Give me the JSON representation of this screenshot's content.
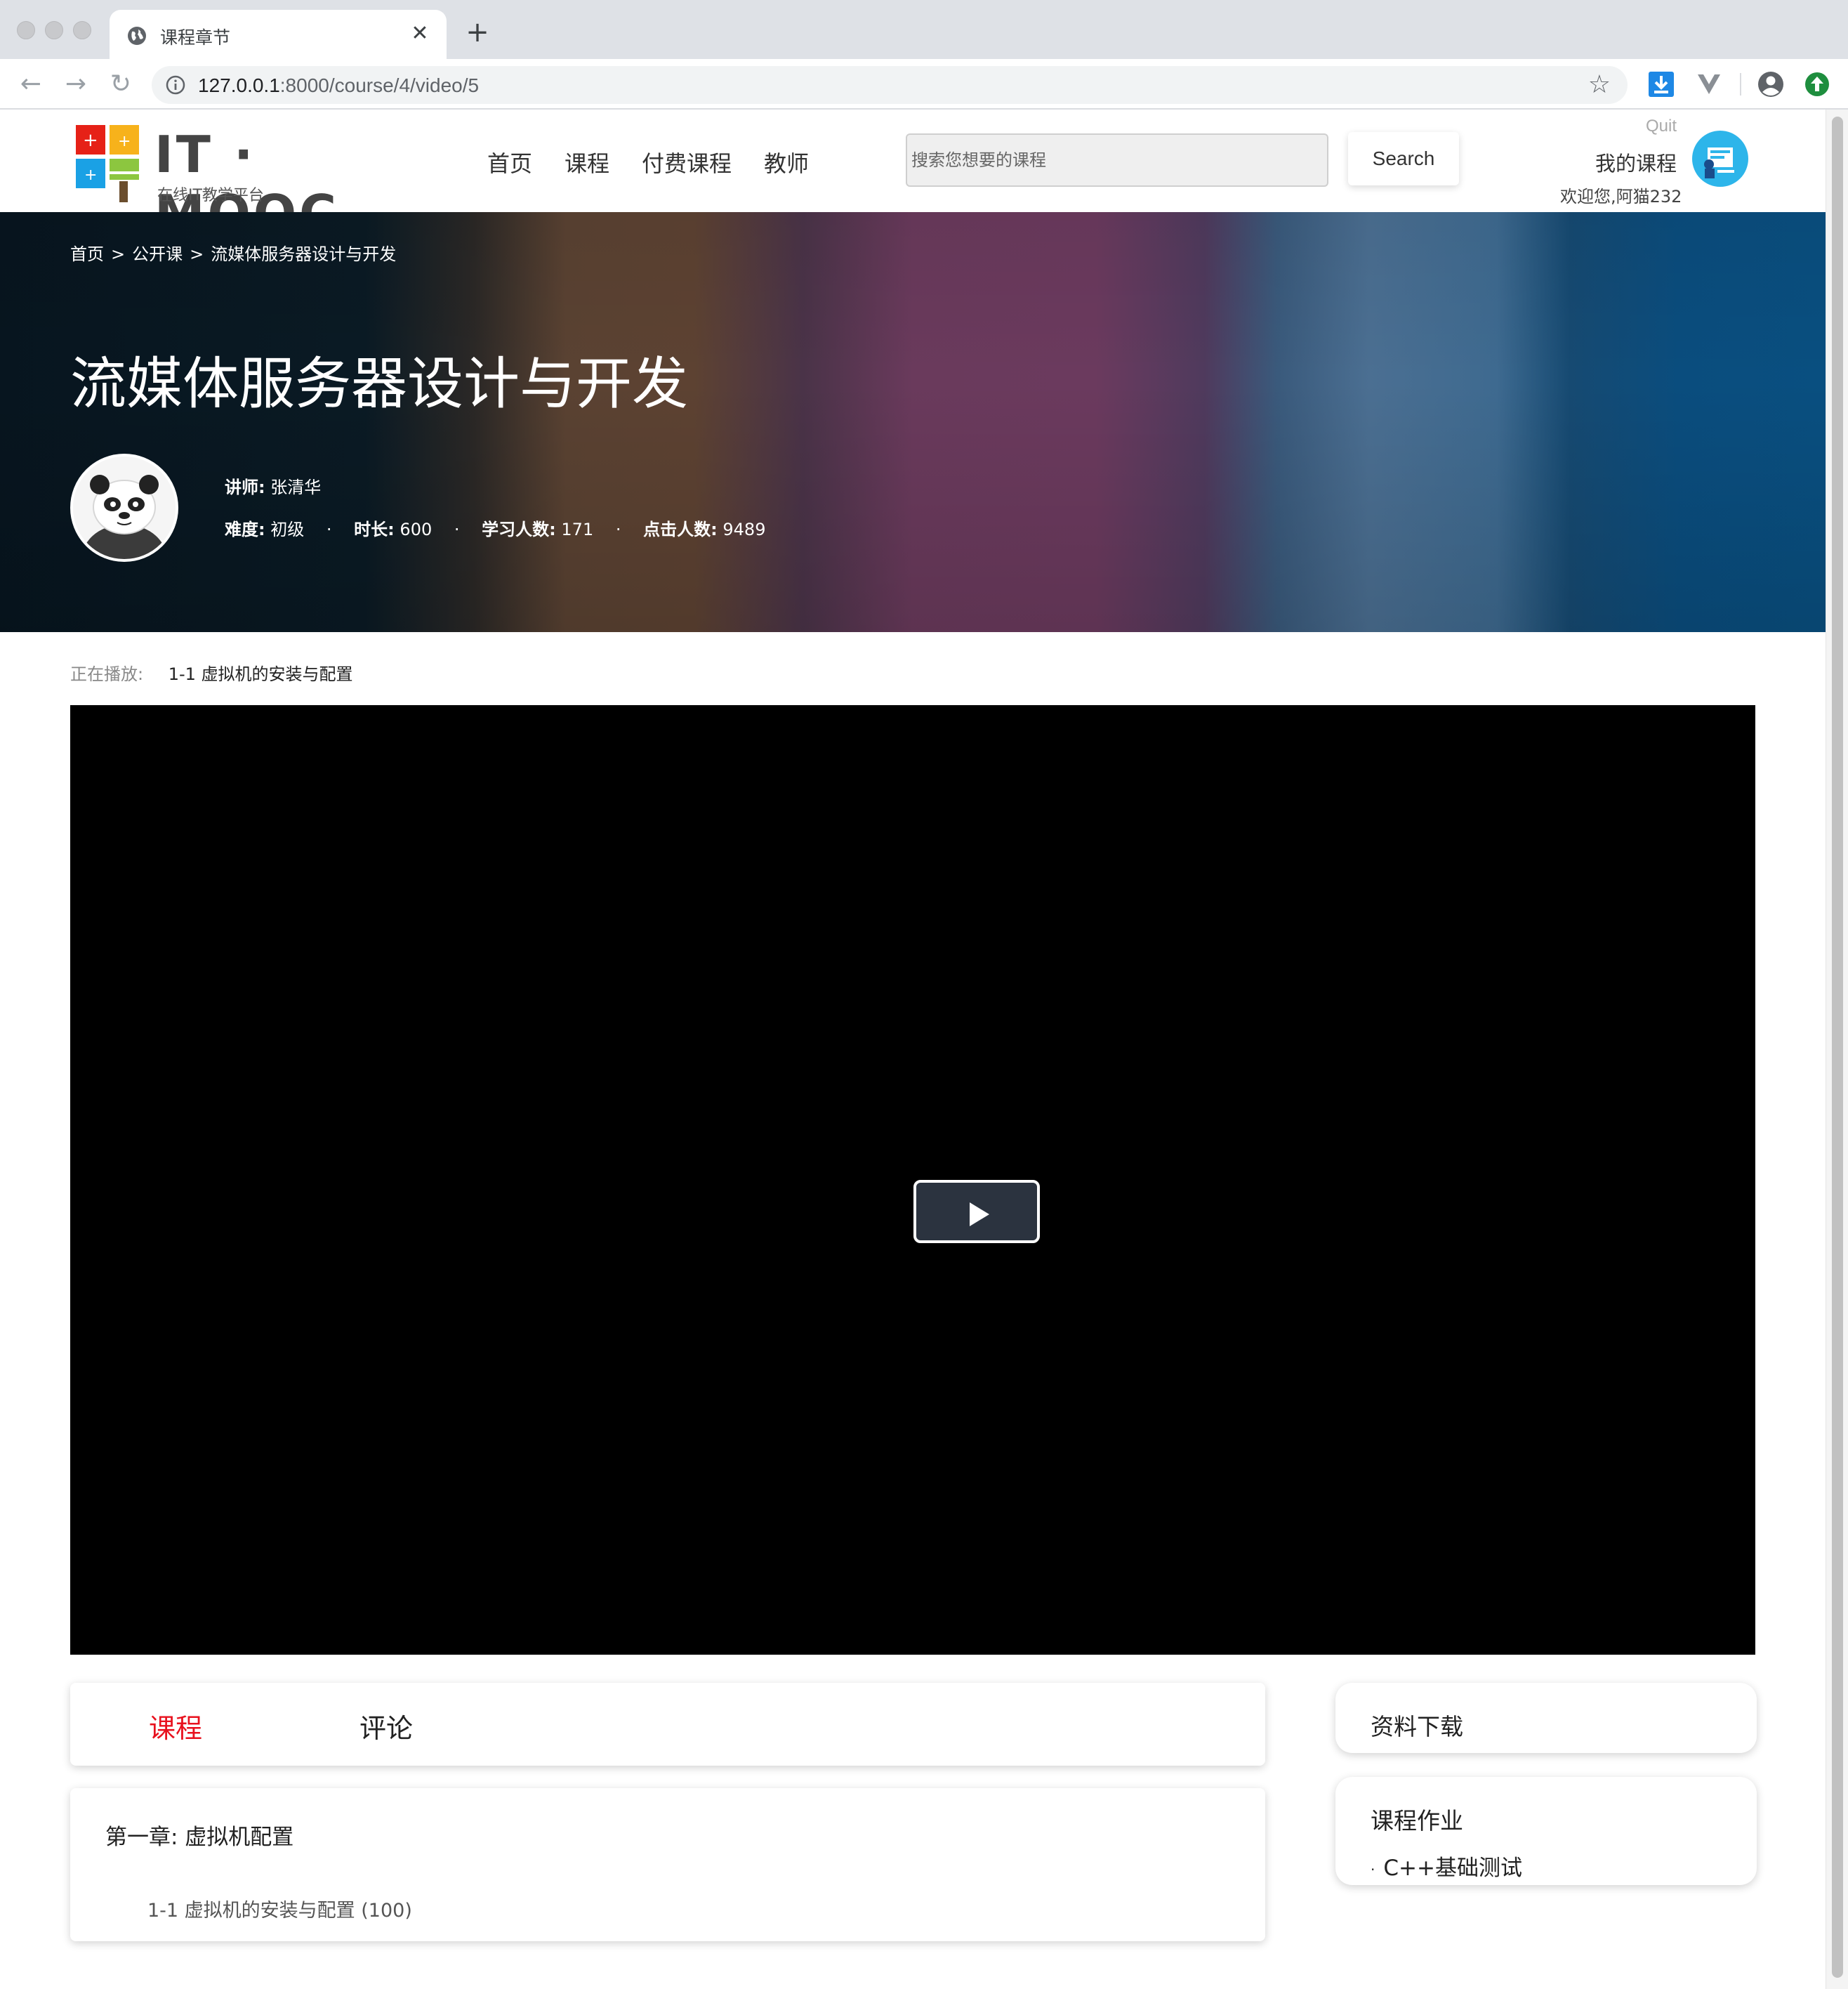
{
  "browser": {
    "tab_title": "课程章节",
    "url_host": "127.0.0.1",
    "url_path": ":8000/course/4/video/5"
  },
  "site": {
    "logo_text": "IT · MOOC",
    "logo_subtitle": "在线IT教学平台",
    "nav": [
      "首页",
      "课程",
      "付费课程",
      "教师"
    ],
    "search_placeholder": "搜索您想要的课程",
    "search_button": "Search",
    "quit": "Quit",
    "my_courses": "我的课程",
    "welcome": "欢迎您,阿猫232"
  },
  "banner": {
    "breadcrumb": [
      "首页",
      ">",
      "公开课",
      ">",
      "流媒体服务器设计与开发"
    ],
    "course_title": "流媒体服务器设计与开发",
    "teacher_label": "讲师:",
    "teacher_name": "张清华",
    "difficulty_label": "难度:",
    "difficulty_value": "初级",
    "duration_label": "时长:",
    "duration_value": "600",
    "students_label": "学习人数:",
    "students_value": "171",
    "clicks_label": "点击人数:",
    "clicks_value": "9489",
    "separator": "·"
  },
  "now_playing": {
    "label": "正在播放:",
    "value": "1-1 虚拟机的安装与配置"
  },
  "tabs": {
    "course": "课程",
    "comment": "评论"
  },
  "chapter": {
    "title": "第一章:  虚拟机配置",
    "lesson": "1-1 虚拟机的安装与配置 (100)"
  },
  "sidebar": {
    "downloads_title": "资料下载",
    "homework_title": "课程作业",
    "homework_bullet": "·",
    "homework_item": "C++基础测试"
  },
  "colors": {
    "active_tab": "#e8111e",
    "video_bg": "#000000",
    "avatar_bg": "#2db5ea"
  }
}
